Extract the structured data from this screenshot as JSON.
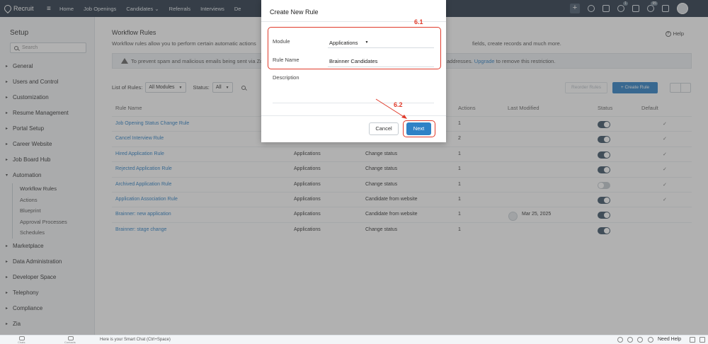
{
  "nav": {
    "brand": "Recruit",
    "items": [
      "Home",
      "Job Openings",
      "Candidates",
      "Referrals",
      "Interviews",
      "De"
    ],
    "candidates_caret": "⌄",
    "badge_a": "1",
    "badge_b": "95"
  },
  "sidebar": {
    "title": "Setup",
    "search_placeholder": "Search",
    "sections_top": [
      "General",
      "Users and Control",
      "Customization",
      "Resume Management",
      "Portal Setup",
      "Career Website",
      "Job Board Hub"
    ],
    "automation": {
      "label": "Automation",
      "subitems": [
        "Workflow Rules",
        "Actions",
        "Blueprint",
        "Approval Processes",
        "Schedules"
      ]
    },
    "sections_bottom": [
      "Marketplace",
      "Data Administration",
      "Developer Space",
      "Telephony",
      "Compliance",
      "Zia"
    ]
  },
  "page": {
    "title": "Workflow Rules",
    "help": "Help",
    "description_left": "Workflow rules allow you to perform certain automatic actions",
    "description_right": "fields, create records and much more.",
    "banner_left": "To prevent spam and malicious emails being sent via Zo",
    "banner_right_prefix": "addresses.",
    "banner_link": "Upgrade",
    "banner_right_suffix": "to remove this restriction.",
    "filters": {
      "list_label": "List of Rules:",
      "list_value": "All Modules",
      "status_label": "Status:",
      "status_value": "All"
    },
    "reorder_label": "Reorder Rules",
    "create_label": "+ Create Rule"
  },
  "table": {
    "headers": {
      "rule_name": "Rule Name",
      "actions": "Actions",
      "last_modified": "Last Modified",
      "status": "Status",
      "default": "Default"
    },
    "rows": [
      {
        "name": "Job Opening Status Change Rule",
        "module": "",
        "trigger": "",
        "actions": "1",
        "modified": "",
        "status": "on",
        "default": "✓"
      },
      {
        "name": "Cancel Interview Rule",
        "module": "",
        "trigger": "",
        "actions": "2",
        "modified": "",
        "status": "on",
        "default": "✓"
      },
      {
        "name": "Hired Application Rule",
        "module": "Applications",
        "trigger": "Change status",
        "actions": "1",
        "modified": "",
        "status": "on",
        "default": "✓"
      },
      {
        "name": "Rejected Application Rule",
        "module": "Applications",
        "trigger": "Change status",
        "actions": "1",
        "modified": "",
        "status": "on",
        "default": "✓"
      },
      {
        "name": "Archived Application Rule",
        "module": "Applications",
        "trigger": "Change status",
        "actions": "1",
        "modified": "",
        "status": "off",
        "default": "✓"
      },
      {
        "name": "Application Association Rule",
        "module": "Applications",
        "trigger": "Candidate from website",
        "actions": "1",
        "modified": "",
        "status": "on",
        "default": "✓"
      },
      {
        "name": "Brainner: new application",
        "module": "Applications",
        "trigger": "Candidate from website",
        "actions": "1",
        "modified": "Mar 25, 2025",
        "status": "on",
        "default": ""
      },
      {
        "name": "Brainner: stage change",
        "module": "Applications",
        "trigger": "Change status",
        "actions": "1",
        "modified": "",
        "status": "on",
        "default": ""
      }
    ]
  },
  "modal": {
    "title": "Create New Rule",
    "module_label": "Module",
    "module_value": "Applications",
    "rule_name_label": "Rule Name",
    "rule_name_value": "Brainner Candidates",
    "description_label": "Description",
    "cancel_label": "Cancel",
    "next_label": "Next"
  },
  "annotations": {
    "step_1": "6.1",
    "step_2": "6.2",
    "color": "#e03a2a"
  },
  "bottombar": {
    "chat_text": "Here is your Smart Chat (Ctrl+Space)",
    "left_caption_1": "Chats",
    "left_caption_2": "Contacts",
    "need_help": "Need Help"
  },
  "colors": {
    "nav_bg": "#2b3a4a",
    "accent": "#2f82c6",
    "toggle_on": "#3f5568"
  }
}
